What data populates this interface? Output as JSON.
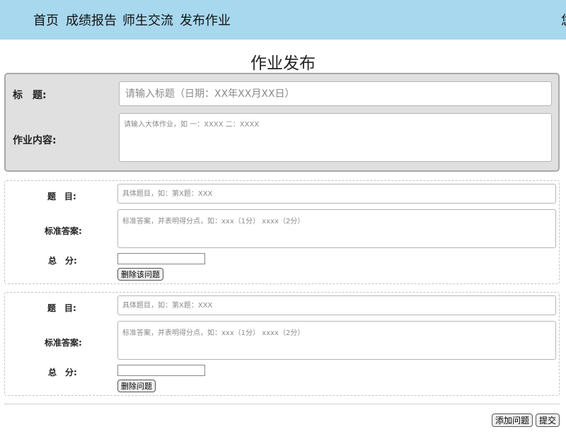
{
  "nav": {
    "items": [
      "首页",
      "成绩报告",
      "师生交流",
      "发布作业"
    ],
    "right_text": "您"
  },
  "page": {
    "title": "作业发布"
  },
  "form": {
    "title_label": "标　题:",
    "title_placeholder": "请输入标题（日期：XX年XX月XX日）",
    "content_label": "作业内容:",
    "content_placeholder": "请输入大体作业，如 一：XXXX 二：XXXX"
  },
  "questions": [
    {
      "question_label": "题　目:",
      "question_placeholder": "具体题目，如：第X题：XXX",
      "answer_label": "标准答案:",
      "answer_placeholder": "标准答案，并表明得分点，如：xxx（1分） xxxx（2分）",
      "score_label": "总　分:",
      "score_value": "",
      "delete_label": "删除该问题"
    },
    {
      "question_label": "题　目:",
      "question_placeholder": "具体题目，如：第X题：XXX",
      "answer_label": "标准答案:",
      "answer_placeholder": "标准答案，并表明得分点，如：xxx（1分） xxxx（2分）",
      "score_label": "总　分:",
      "score_value": "",
      "delete_label": "删除问题"
    }
  ],
  "footer": {
    "add_label": "添加问题",
    "submit_label": "提交"
  }
}
